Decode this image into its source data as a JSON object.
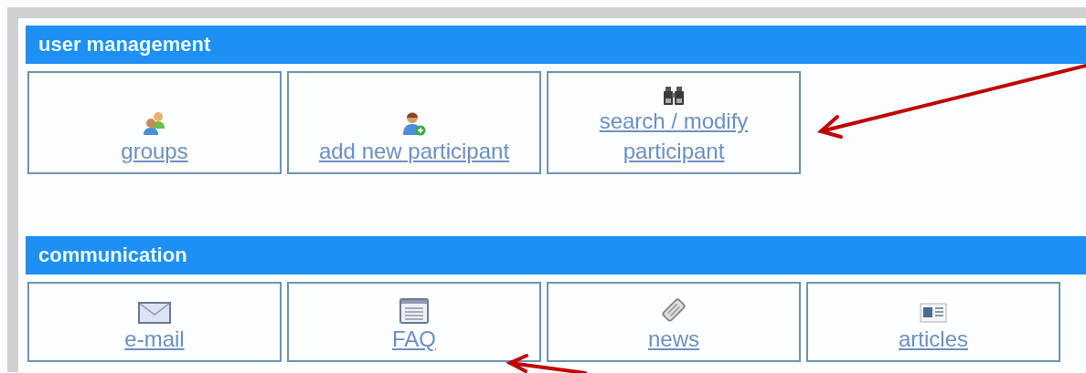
{
  "sections": [
    {
      "title": "user management",
      "tiles": [
        {
          "label": "groups"
        },
        {
          "label": "add new participant"
        },
        {
          "label": "search / modify participant"
        }
      ]
    },
    {
      "title": "communication",
      "tiles": [
        {
          "label": "e-mail"
        },
        {
          "label": "FAQ"
        },
        {
          "label": "news"
        },
        {
          "label": "articles"
        }
      ]
    }
  ]
}
